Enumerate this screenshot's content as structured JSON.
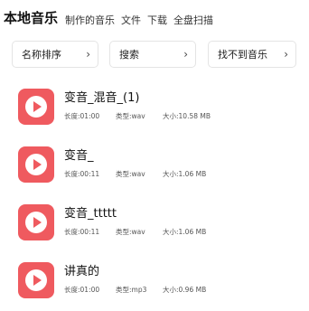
{
  "header": {
    "tabs": [
      {
        "label": "本地音乐",
        "active": true
      },
      {
        "label": "制作的音乐",
        "active": false
      },
      {
        "label": "文件",
        "active": false
      },
      {
        "label": "下载",
        "active": false
      },
      {
        "label": "全盘扫描",
        "active": false
      }
    ]
  },
  "toolbar": {
    "sort_label": "名称排序",
    "search_label": "搜索",
    "not_found_label": "找不到音乐",
    "chevron_icon": "chevron-right-icon"
  },
  "songs": [
    {
      "title": "变音_混音_(1)",
      "length": "长度:01:00",
      "type": "类型:wav",
      "size": "大小:10.58 MB"
    },
    {
      "title": "变音_",
      "length": "长度:00:11",
      "type": "类型:wav",
      "size": "大小:1.06 MB"
    },
    {
      "title": "变音_ttttt",
      "length": "长度:00:11",
      "type": "类型:wav",
      "size": "大小:1.06 MB"
    },
    {
      "title": "讲真的",
      "length": "长度:01:00",
      "type": "类型:mp3",
      "size": "大小:0.96 MB"
    }
  ],
  "colors": {
    "accent": "#ef5a5f",
    "text": "#111111",
    "meta_text": "#555555",
    "border": "#e4e4e4"
  }
}
